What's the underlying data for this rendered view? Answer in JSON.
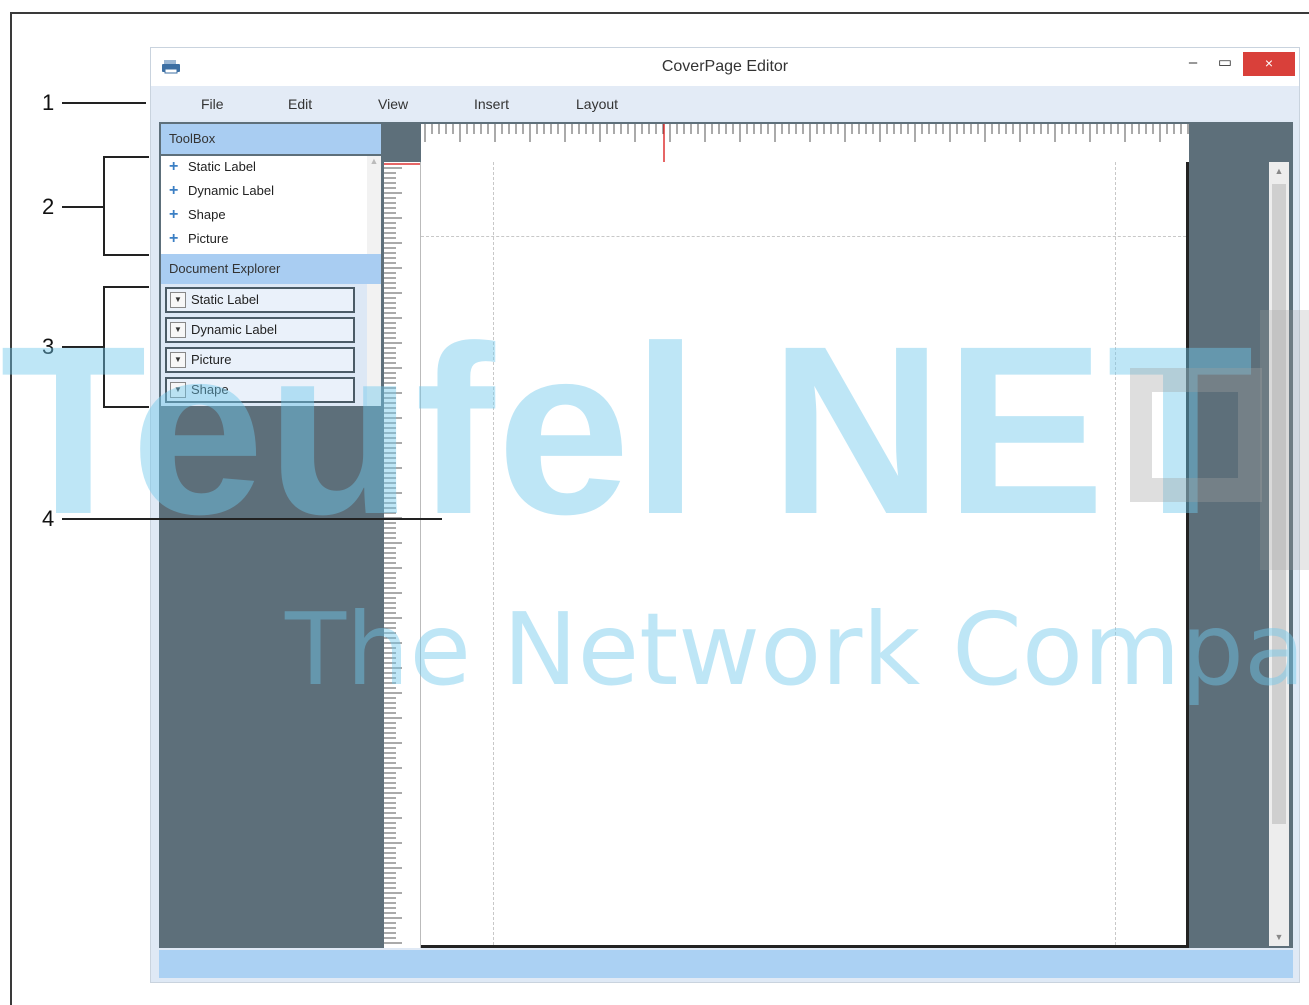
{
  "window": {
    "title": "CoverPage Editor",
    "minimize": "‒",
    "maximize": "▭",
    "close": "×"
  },
  "menu": [
    "File",
    "Edit",
    "View",
    "Insert",
    "Layout"
  ],
  "toolbox": {
    "header": "ToolBox",
    "items": [
      "Static Label",
      "Dynamic Label",
      "Shape",
      "Picture"
    ]
  },
  "explorer": {
    "header": "Document Explorer",
    "items": [
      "Static Label",
      "Dynamic Label",
      "Picture",
      "Shape"
    ]
  },
  "callouts": [
    "1",
    "2",
    "3",
    "4"
  ],
  "watermark": {
    "main": "Teufel NET",
    "sub": "The Network Company."
  },
  "colors": {
    "accent": "#a9cdf2",
    "close": "#d9403a",
    "workspace": "#5d6f7a",
    "watermark": "#6ec8eb"
  }
}
